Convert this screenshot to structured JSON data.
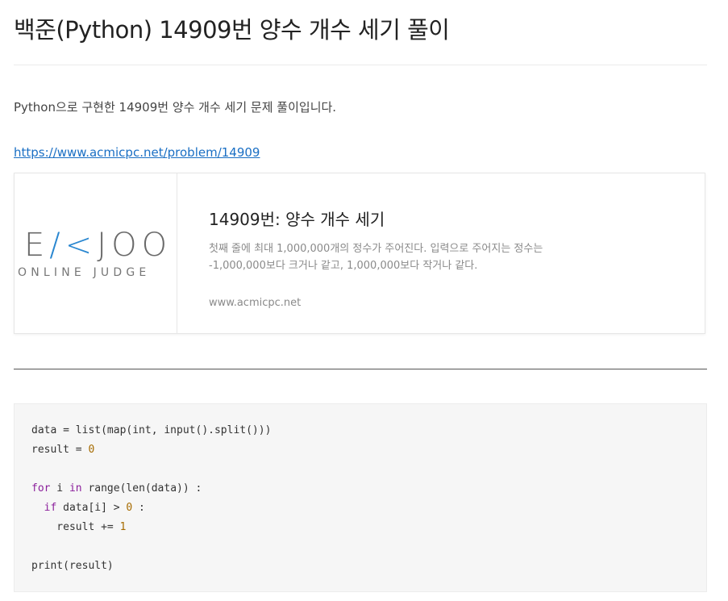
{
  "post": {
    "title": "백준(Python) 14909번 양수 개수 세기 풀이",
    "intro": "Python으로 구현한 14909번 양수 개수 세기 문제 풀이입니다.",
    "link": "https://www.acmicpc.net/problem/14909"
  },
  "card": {
    "logo_letters": [
      "E",
      "/",
      "<",
      "J",
      "O",
      "O"
    ],
    "logo_sub": "ONLINE JUDGE",
    "title": "14909번: 양수 개수 세기",
    "desc": "첫째 줄에 최대 1,000,000개의 정수가 주어진다. 입력으로 주어지는 정수는 -1,000,000보다 크거나 같고, 1,000,000보다 작거나 같다.",
    "host": "www.acmicpc.net"
  },
  "code": {
    "line1": "data = list(map(int, input().split()))",
    "line2a": "result = ",
    "line2b": "0",
    "line4a": "for",
    "line4b": " i ",
    "line4c": "in",
    "line4d": " range(len(data)) :",
    "line5a": "  ",
    "line5b": "if",
    "line5c": " data[i] > ",
    "line5d": "0",
    "line5e": " :",
    "line6a": "    result += ",
    "line6b": "1",
    "line8": "print(result)"
  },
  "colors": {
    "link": "#1a6fc4",
    "logo_accent": "#2a87d0",
    "keyword": "#8b1f9b",
    "number": "#a66b00"
  }
}
